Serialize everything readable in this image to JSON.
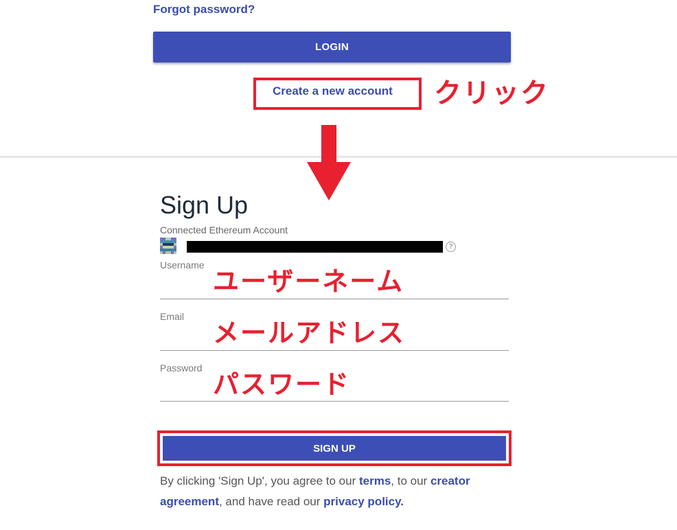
{
  "login": {
    "forgot_password": "Forgot password?",
    "login_label": "LOGIN",
    "create_account": "Create a new account"
  },
  "annotations": {
    "click": "クリック",
    "username": "ユーザーネーム",
    "email": "メールアドレス",
    "password": "パスワード"
  },
  "signup": {
    "title": "Sign Up",
    "connected_account_label": "Connected Ethereum Account",
    "username_label": "Username",
    "email_label": "Email",
    "password_label": "Password",
    "submit_label": "SIGN UP",
    "terms": {
      "prefix": "By clicking 'Sign Up', you agree to our ",
      "terms_link": "terms",
      "middle1": ", to our ",
      "creator_link": "creator agreement",
      "middle2": ", and have read our ",
      "privacy_link": "privacy policy."
    }
  },
  "colors": {
    "brand_blue": "#3d4fb7",
    "link_blue": "#3b4cac",
    "annotation_red": "#e8202f"
  },
  "icons": [
    "identicon",
    "help-icon",
    "down-arrow-icon"
  ]
}
